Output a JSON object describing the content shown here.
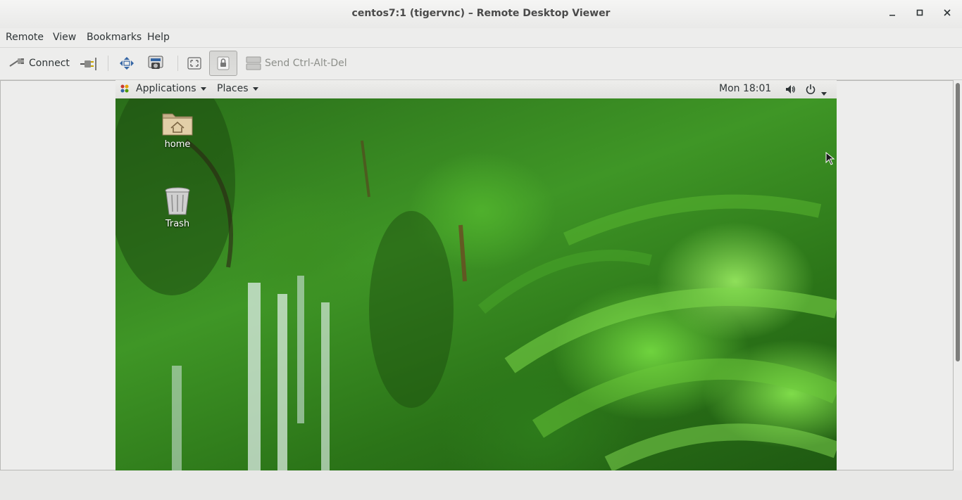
{
  "window": {
    "title": "centos7:1 (tigervnc) – Remote Desktop Viewer",
    "minimize_icon": "minimize-icon",
    "maximize_icon": "maximize-icon",
    "close_icon": "close-icon"
  },
  "menubar": {
    "items": [
      "Remote",
      "View",
      "Bookmarks",
      "Help"
    ]
  },
  "toolbar": {
    "connect_label": "Connect",
    "send_ctrl_alt_del_label": "Send Ctrl-Alt-Del",
    "keyboard_grab_toggled": true
  },
  "remote_desktop": {
    "panel": {
      "applications_label": "Applications",
      "places_label": "Places",
      "clock": "Mon 18:01"
    },
    "icons": [
      {
        "label": "home",
        "icon": "home-folder-icon"
      },
      {
        "label": "Trash",
        "icon": "trash-icon"
      }
    ]
  }
}
